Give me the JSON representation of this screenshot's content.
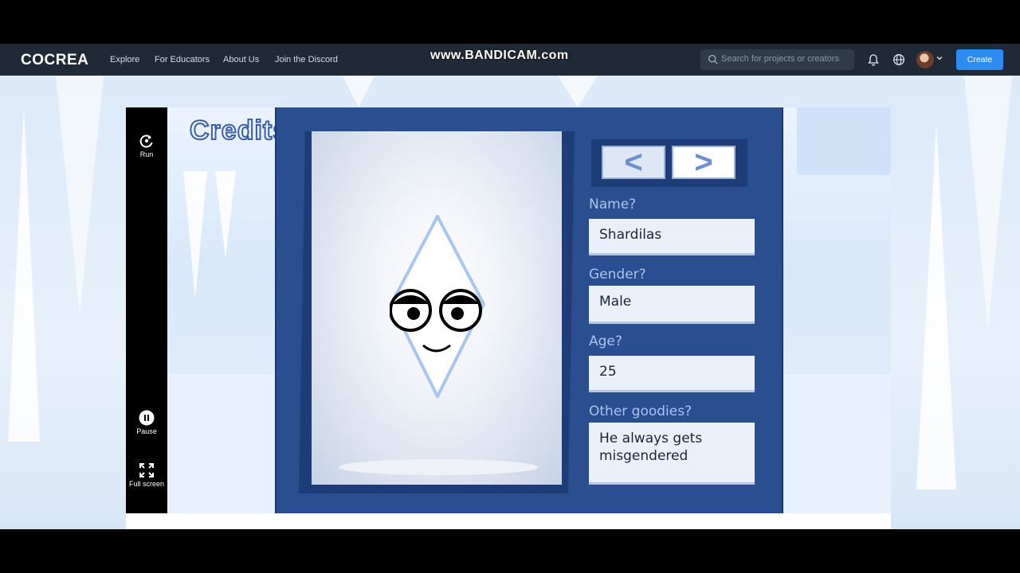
{
  "nav": {
    "logo": "COCREA",
    "links": [
      "Explore",
      "For Educators",
      "About Us",
      "Join the Discord"
    ],
    "watermark": "www.BANDICAM.com",
    "search_placeholder": "Search for projects or creators",
    "create_label": "Create"
  },
  "toolbar": {
    "run_label": "Run",
    "pause_label": "Pause",
    "fullscreen_label": "Full screen"
  },
  "stage": {
    "title": "Credits",
    "prev_symbol": "<",
    "next_symbol": ">",
    "fields": [
      {
        "label": "Name?",
        "value": "Shardilas"
      },
      {
        "label": "Gender?",
        "value": "Male"
      },
      {
        "label": "Age?",
        "value": "25"
      },
      {
        "label": "Other goodies?",
        "value": "He always gets misgendered"
      }
    ]
  },
  "icons": [
    "search-icon",
    "bell-icon",
    "globe-icon",
    "chevron-down-icon",
    "run-icon",
    "pause-icon",
    "fullscreen-icon"
  ],
  "colors": {
    "nav_bg": "#1f2a36",
    "accent": "#2d8cf0",
    "card_bg": "#2b4e91",
    "label": "#a9c2ef"
  }
}
